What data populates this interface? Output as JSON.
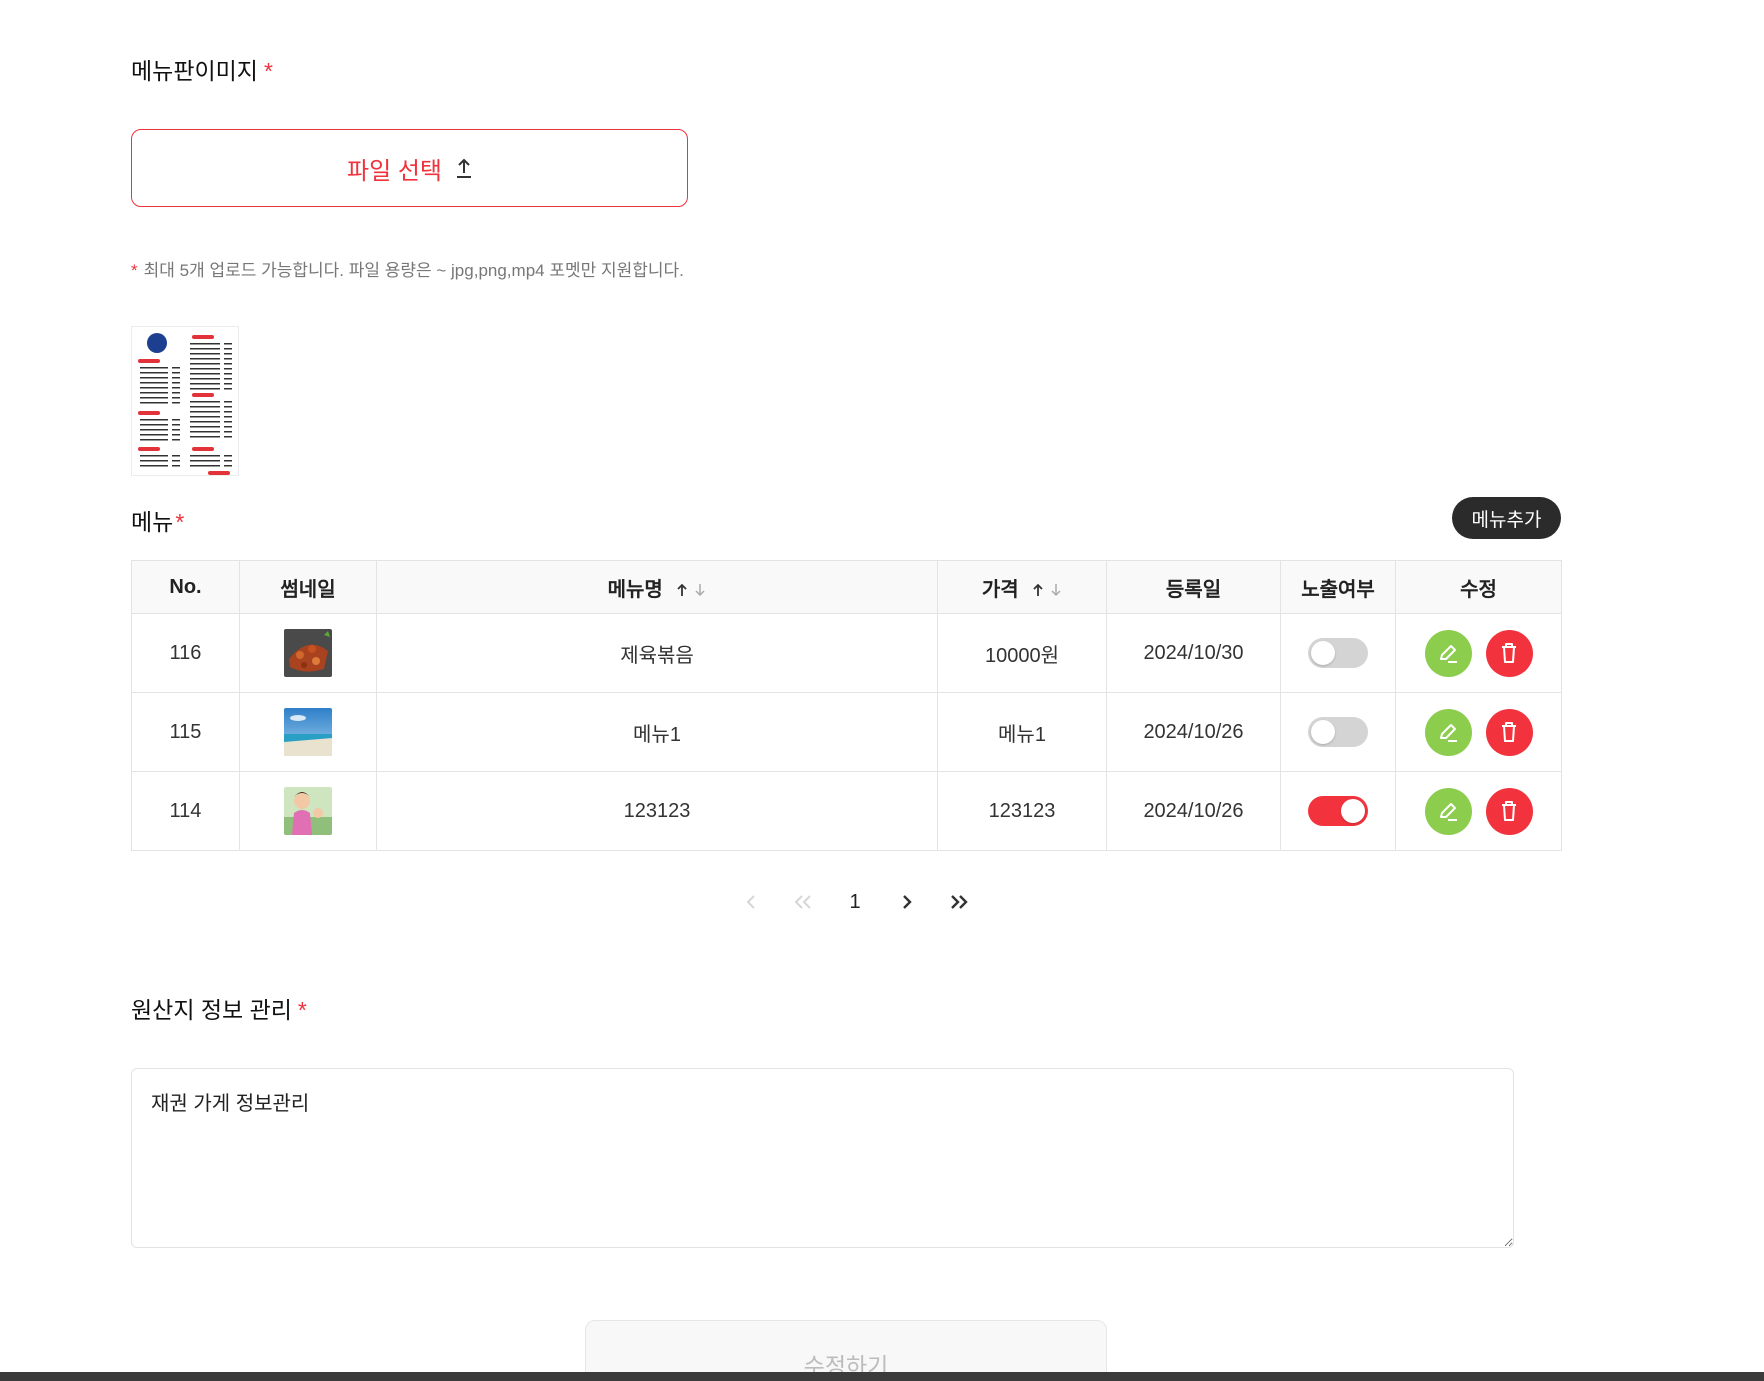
{
  "menu_image_section": {
    "title": "메뉴판이미지",
    "required_mark": "*",
    "file_button_label": "파일 선택",
    "hint_star": "*",
    "hint": "최대 5개 업로드 가능합니다. 파일 용량은 ~ jpg,png,mp4 포멧만 지원합니다."
  },
  "menu_section": {
    "title": "메뉴",
    "required_mark": "*",
    "add_button": "메뉴추가",
    "columns": [
      "No.",
      "썸네일",
      "메뉴명",
      "가격",
      "등록일",
      "노출여부",
      "수정"
    ],
    "rows": [
      {
        "no": "116",
        "name": "제육볶음",
        "price": "10000원",
        "date": "2024/10/30",
        "visible": false
      },
      {
        "no": "115",
        "name": "메뉴1",
        "price": "메뉴1",
        "date": "2024/10/26",
        "visible": false
      },
      {
        "no": "114",
        "name": "123123",
        "price": "123123",
        "date": "2024/10/26",
        "visible": true
      }
    ],
    "pagination": {
      "current_page": "1"
    }
  },
  "origin_section": {
    "title": "원산지 정보 관리",
    "required_mark": "*",
    "text": "재권 가게 정보관리"
  },
  "submit_label": "수정하기",
  "colors": {
    "accent_red": "#f0323c",
    "edit_green": "#8ccd4d",
    "dark_button": "#2b2b2b"
  }
}
